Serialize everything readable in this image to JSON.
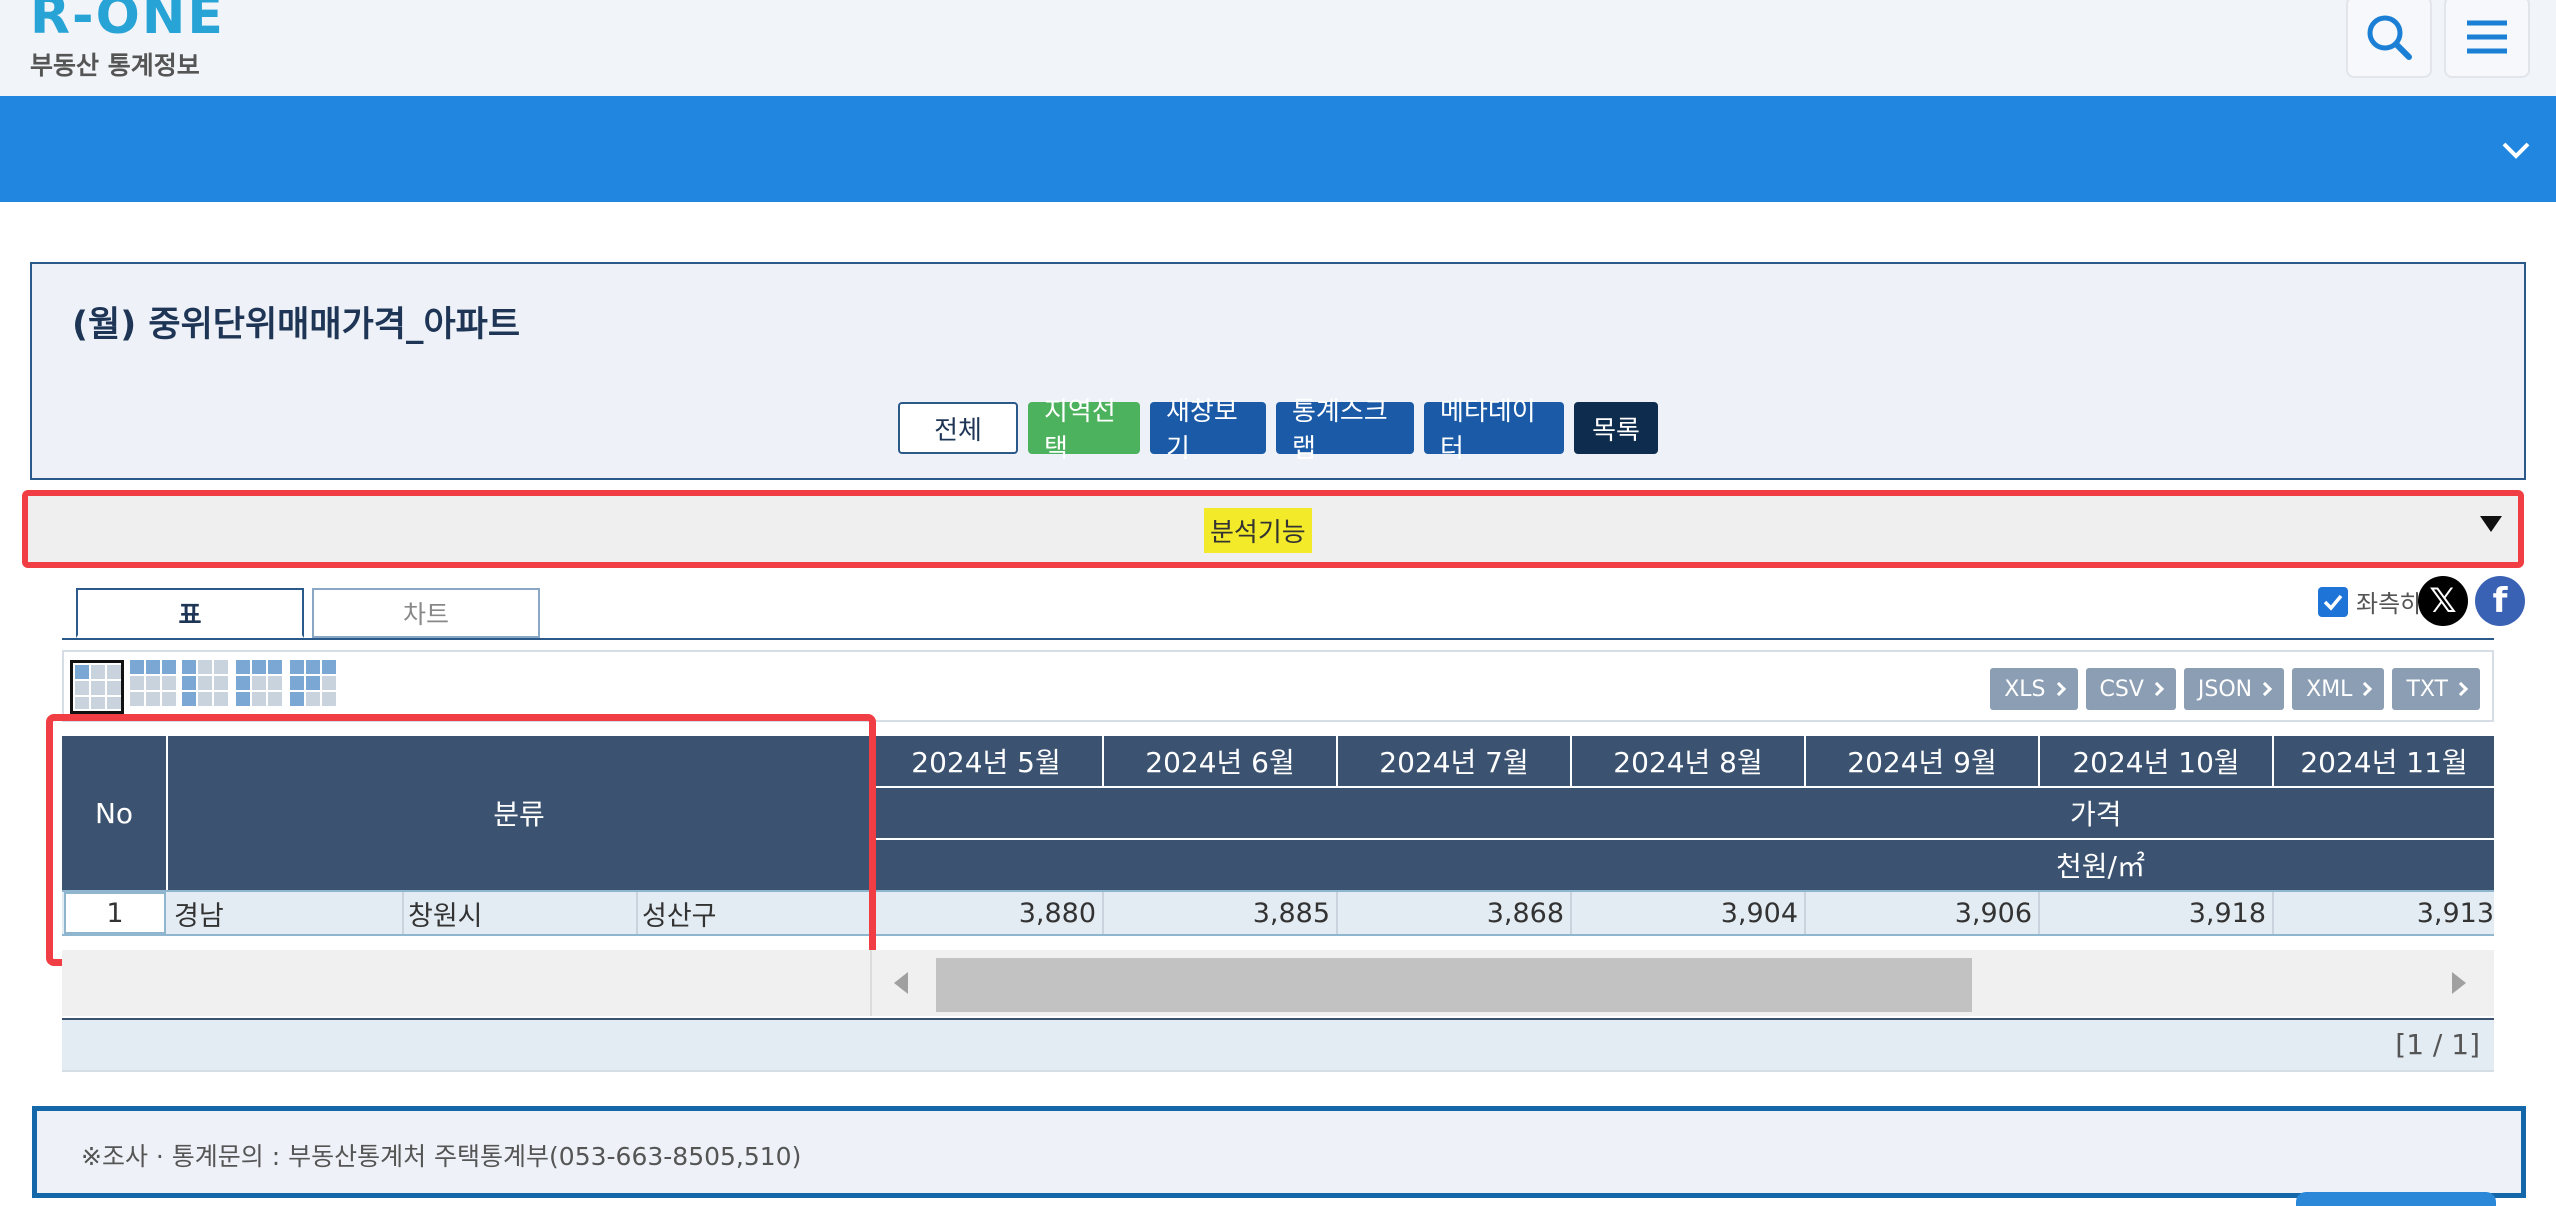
{
  "header": {
    "logo_text": "R-ONE",
    "logo_sub": "부동산 통계정보",
    "search_icon": "search-icon",
    "menu_icon": "hamburger-menu-icon"
  },
  "panel": {
    "title": "(월) 중위단위매매가격_아파트",
    "buttons": {
      "all": "전체",
      "region": "지역선택",
      "new_window": "새창보기",
      "scrap": "통계스크랩",
      "metadata": "메타데이터",
      "list": "목록"
    }
  },
  "analysis": {
    "label": "분석기능"
  },
  "tabs": {
    "table": "표",
    "chart": "차트"
  },
  "left_fix": {
    "label": "좌측하",
    "checked": true
  },
  "downloads": [
    "XLS",
    "CSV",
    "JSON",
    "XML",
    "TXT"
  ],
  "table": {
    "no_header": "No",
    "category_header": "분류",
    "months": [
      "2024년 5월",
      "2024년 6월",
      "2024년 7월",
      "2024년 8월",
      "2024년 9월",
      "2024년 10월",
      "2024년 11월"
    ],
    "item_header": "가격",
    "unit_header": "천원/㎡",
    "rows": [
      {
        "no": "1",
        "region1": "경남",
        "region2": "창원시",
        "region3": "성산구",
        "values": [
          "3,880",
          "3,885",
          "3,868",
          "3,904",
          "3,906",
          "3,918",
          "3,913"
        ]
      }
    ]
  },
  "pager": {
    "text": "[1 / 1]"
  },
  "footer": {
    "text": "※조사 · 통계문의 : 부동산통계처 주택통계부(053-663-8505,510)"
  },
  "colors": {
    "brand_blue": "#2186e0",
    "navy": "#3b5370",
    "highlight_red": "#f03e44",
    "highlight_yellow": "#f3ea2a",
    "green": "#4db25d"
  }
}
